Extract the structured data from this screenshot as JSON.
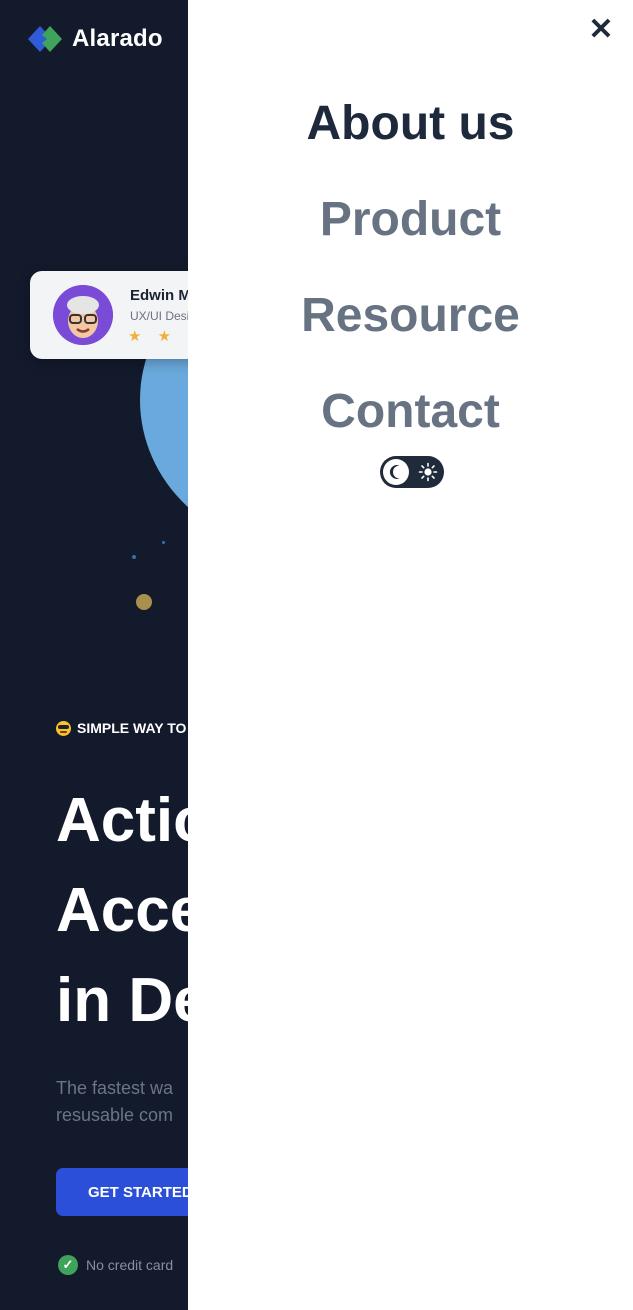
{
  "brand": {
    "name": "Alarado"
  },
  "testimonial": {
    "name": "Edwin M",
    "role": "UX/UI Desi",
    "stars": "★ ★ ★"
  },
  "hero": {
    "eyebrow": "SIMPLE WAY TO C",
    "headline_lines": [
      "Actio",
      "Acce",
      "in De"
    ],
    "subtext_lines": [
      "The fastest wa",
      "resusable com"
    ],
    "cta_label": "GET STARTED",
    "note": "No credit card"
  },
  "menu": {
    "items": [
      {
        "label": "About us",
        "active": true
      },
      {
        "label": "Product",
        "active": false
      },
      {
        "label": "Resource",
        "active": false
      },
      {
        "label": "Contact",
        "active": false
      }
    ],
    "close_icon": "close-icon",
    "theme_toggle_icons": [
      "moon-icon",
      "sun-icon"
    ]
  },
  "colors": {
    "background": "#131a2c",
    "drawer": "#ffffff",
    "menu_active": "#1e293b",
    "menu_inactive": "#677382",
    "accent_blue": "#2b4fd8",
    "logo_blue": "#2f5bd6",
    "logo_green": "#3fa35b",
    "star": "#f2b136"
  }
}
